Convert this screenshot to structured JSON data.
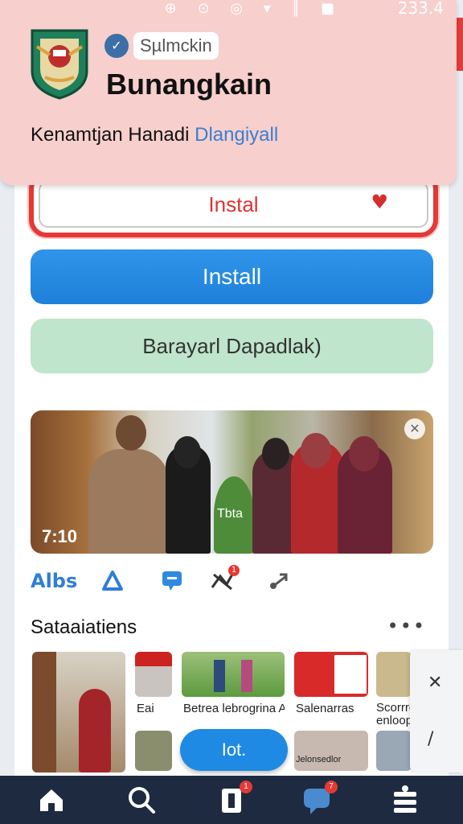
{
  "status_bar": {
    "icons": "⊕ ⊙ ◎ ▾ ║ ■",
    "time": "233.4"
  },
  "header": {
    "chip_label": "Sµlmckin",
    "title": "Bunangkain",
    "subtitle_main": "Kenamtjan Hanadi",
    "subtitle_accent": "Dlangiyall"
  },
  "buttons": {
    "outline_label": "Instal",
    "outline_icon": "heart-icon",
    "primary_label": "Install",
    "secondary_label": "Barayarl Dapadlak)"
  },
  "video": {
    "time": "7:10",
    "overlay_label": "Tbta"
  },
  "actions": {
    "first_label": "Albs",
    "badge_count": "1"
  },
  "section": {
    "title": "Sataaiatiens",
    "more": "•••"
  },
  "thumbnails": {
    "labels": [
      "Eai",
      "Betrea lebrogrina AV",
      "Salenarras",
      "Scorrro enloops"
    ],
    "row2_caption": "Jelonsedlor"
  },
  "side_tools": {
    "top": "✕",
    "bottom": "/"
  },
  "fab_label": "Iot.",
  "bottom_nav": {
    "items": [
      {
        "name": "home"
      },
      {
        "name": "search"
      },
      {
        "name": "notifications",
        "badge": "1"
      },
      {
        "name": "messages",
        "badge": "7"
      },
      {
        "name": "profile"
      }
    ]
  },
  "colors": {
    "header_bg": "#f7cfcd",
    "close_red": "#e43c3a",
    "primary_blue": "#1f7fd9",
    "secondary_green": "#bfe5cc",
    "nav_dark": "#1e2a3f"
  }
}
